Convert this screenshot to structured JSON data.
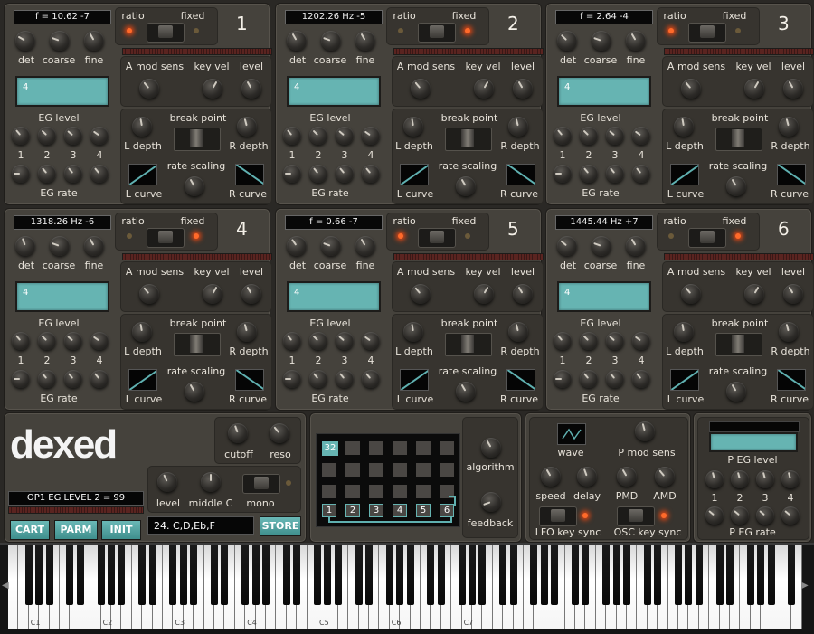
{
  "operators": [
    {
      "num": "1",
      "freq": "f = 10.62 -7",
      "led_ratio": true,
      "led_fixed": false
    },
    {
      "num": "2",
      "freq": "1202.26 Hz -5",
      "led_ratio": false,
      "led_fixed": true
    },
    {
      "num": "3",
      "freq": "f = 2.64 -4",
      "led_ratio": true,
      "led_fixed": false
    },
    {
      "num": "4",
      "freq": "1318.26 Hz -6",
      "led_ratio": false,
      "led_fixed": true
    },
    {
      "num": "5",
      "freq": "f = 0.66 -7",
      "led_ratio": true,
      "led_fixed": false
    },
    {
      "num": "6",
      "freq": "1445.44 Hz +7",
      "led_ratio": false,
      "led_fixed": true
    }
  ],
  "op_labels": {
    "ratio": "ratio",
    "fixed": "fixed",
    "det": "det",
    "coarse": "coarse",
    "fine": "fine",
    "a_mod_sens": "A mod sens",
    "key_vel": "key vel",
    "level": "level",
    "eg_level": "EG level",
    "eg_rate": "EG rate",
    "break_point": "break point",
    "l_depth": "L depth",
    "r_depth": "R depth",
    "rate_scaling": "rate scaling",
    "l_curve": "L curve",
    "r_curve": "R curve",
    "lcd_value": "4",
    "n1": "1",
    "n2": "2",
    "n3": "3",
    "n4": "4"
  },
  "global": {
    "logo": "dexed",
    "cutoff": "cutoff",
    "reso": "reso",
    "level": "level",
    "middle_c": "middle C",
    "mono": "mono",
    "status": "OP1 EG LEVEL 2 = 99",
    "cart": "CART",
    "parm": "PARM",
    "init": "INIT",
    "program": "24. C,D,Eb,F",
    "store": "STORE",
    "algorithm": "algorithm",
    "feedback": "feedback",
    "algo_number": "32",
    "algo_ops": [
      "1",
      "2",
      "3",
      "4",
      "5",
      "6"
    ],
    "wave": "wave",
    "p_mod_sens": "P mod sens",
    "speed": "speed",
    "delay": "delay",
    "pmd": "PMD",
    "amd": "AMD",
    "lfo_key_sync": "LFO key sync",
    "osc_key_sync": "OSC key sync",
    "p_eg_level": "P EG level",
    "p_eg_rate": "P EG rate",
    "pn1": "1",
    "pn2": "2",
    "pn3": "3",
    "pn4": "4"
  },
  "keyboard": {
    "octaves": [
      "C1",
      "C2",
      "C3",
      "C4",
      "C5",
      "C6",
      "C7"
    ]
  },
  "colors": {
    "accent": "#66b4b2",
    "led": "#ff6a2a",
    "panel": "#45423c"
  }
}
